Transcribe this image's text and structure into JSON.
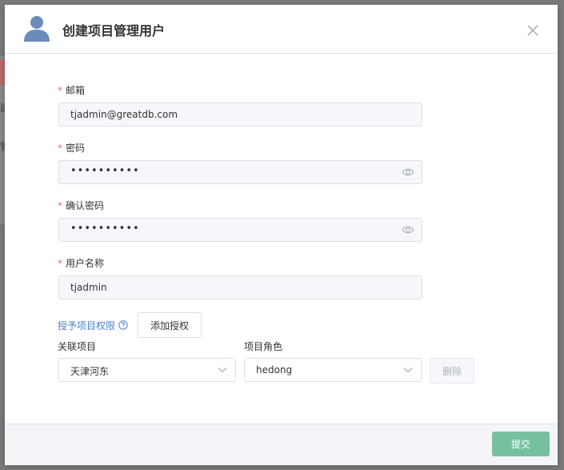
{
  "background": {
    "fragment_1": "建",
    "fragment_2": "管"
  },
  "dialog": {
    "title": "创建项目管理用户",
    "icons": {
      "avatar": "user-icon",
      "close": "close-icon"
    }
  },
  "form": {
    "required_mark": "*",
    "email": {
      "label": "邮箱",
      "value": "tjadmin@greatdb.com"
    },
    "password": {
      "label": "密码",
      "value": "••••••••••"
    },
    "confirm_password": {
      "label": "确认密码",
      "value": "••••••••••"
    },
    "username": {
      "label": "用户名称",
      "value": "tjadmin"
    }
  },
  "grant": {
    "link_label": "授予项目权限",
    "add_button": "添加授权",
    "project_label": "关联项目",
    "role_label": "项目角色",
    "project_value": "天津河东",
    "role_value": "hedong",
    "delete_button": "删除"
  },
  "footer": {
    "submit": "提交"
  },
  "colors": {
    "required": "#f56c6c",
    "link": "#4a7fd0",
    "submit": "#76c09e",
    "avatar": "#6b8cba"
  }
}
